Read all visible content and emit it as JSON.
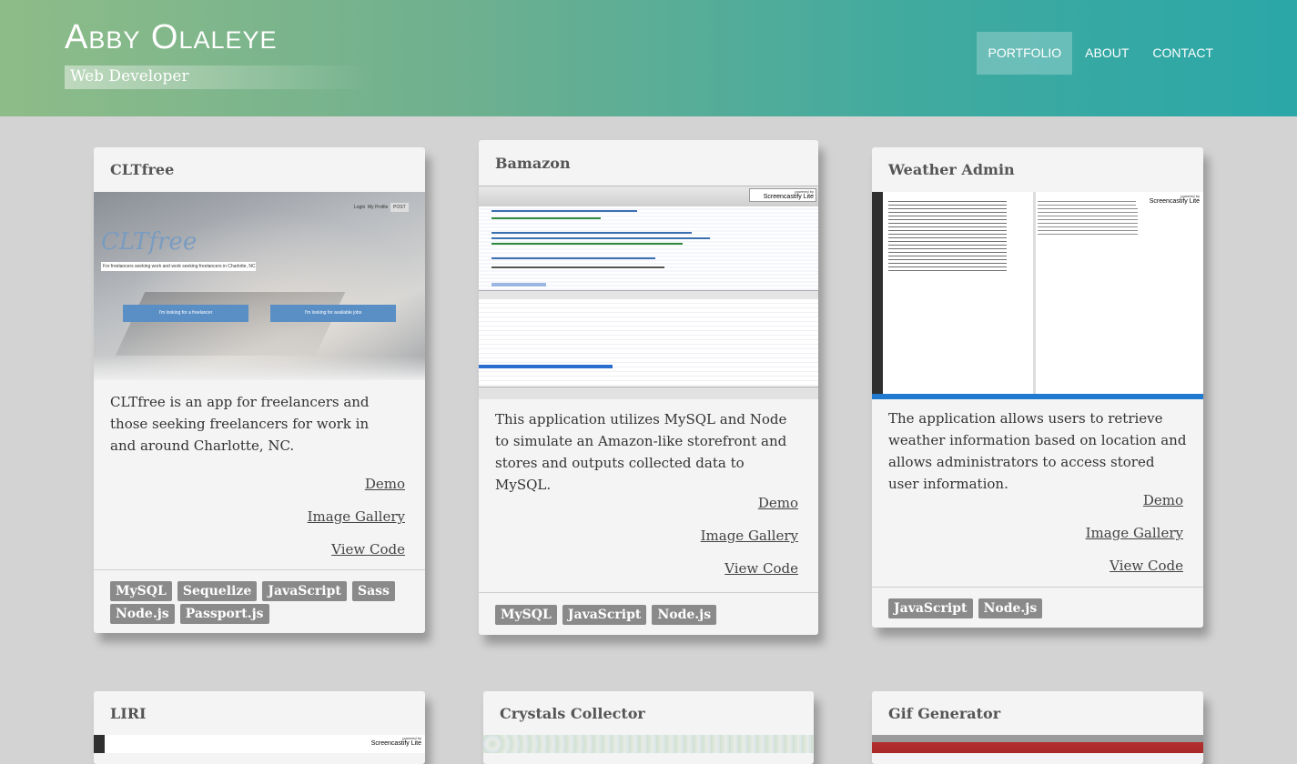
{
  "header": {
    "brand": "Abby Olaleye",
    "subtitle": "Web Developer",
    "nav": [
      "Portfolio",
      "About",
      "Contact"
    ]
  },
  "cards": [
    {
      "title": "CLTfree",
      "description": "CLTfree is an app for freelancers and those seeking freelancers for work in and around Charlotte, NC.",
      "links": [
        "Demo",
        "Image Gallery",
        "View Code"
      ],
      "tags": [
        "MySQL",
        "Sequelize",
        "JavaScript",
        "Sass",
        "Node.js",
        "Passport.js"
      ],
      "shot": {
        "logo": "CLTfree",
        "tagline": "For freelancers seeking work and work seeking freelancers in Charlotte, NC.",
        "btn1": "I'm looking for a freelancer",
        "btn2": "I'm looking for available jobs",
        "menu": [
          "Login",
          "My Profile",
          "POST"
        ]
      }
    },
    {
      "title": "Bamazon",
      "description": "This application utilizes MySQL and Node to simulate an Amazon-like storefront and stores and outputs collected data to MySQL.",
      "links": [
        "Demo",
        "Image Gallery",
        "View Code"
      ],
      "tags": [
        "MySQL",
        "JavaScript",
        "Node.js"
      ],
      "shot": {
        "watermark_top": "powered by",
        "watermark": "Screencastify Lite"
      }
    },
    {
      "title": "Weather Admin",
      "description": "The application allows users to retrieve weather information based on location and allows administrators to access stored user information.",
      "links": [
        "Demo",
        "Image Gallery",
        "View Code"
      ],
      "tags": [
        "JavaScript",
        "Node.js"
      ],
      "shot": {
        "watermark_top": "powered by",
        "watermark": "Screencastify Lite"
      }
    },
    {
      "title": "LIRI",
      "shot": {
        "watermark_top": "powered by",
        "watermark": "Screencastify Lite"
      }
    },
    {
      "title": "Crystals Collector"
    },
    {
      "title": "Gif Generator"
    }
  ]
}
